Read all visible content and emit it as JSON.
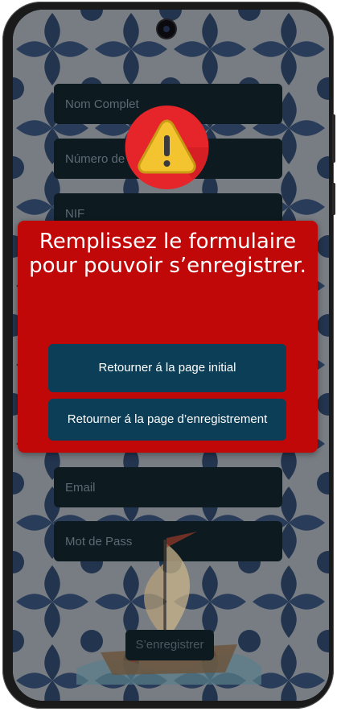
{
  "form": {
    "fields": [
      {
        "label": "Nom Complet"
      },
      {
        "label": "Número de ... il"
      },
      {
        "label": "NIF"
      },
      {
        "label": "Email"
      },
      {
        "label": "Mot de Pass"
      }
    ],
    "submit_label": "S’enregistrer"
  },
  "dialog": {
    "icon": "warning-triangle-icon",
    "message": "Remplissez le formulaire pour pouvoir s’enregistrer.",
    "buttons": [
      {
        "label": "Retourner á la page initial"
      },
      {
        "label": "Retourner á la page  d’enregistrement"
      }
    ]
  },
  "colors": {
    "dialog_bg": "#c10808",
    "button_bg": "#0d3e57",
    "field_bg": "#0d1a20",
    "warning_circle": "#e5252a",
    "warning_triangle": "#f4c430"
  }
}
